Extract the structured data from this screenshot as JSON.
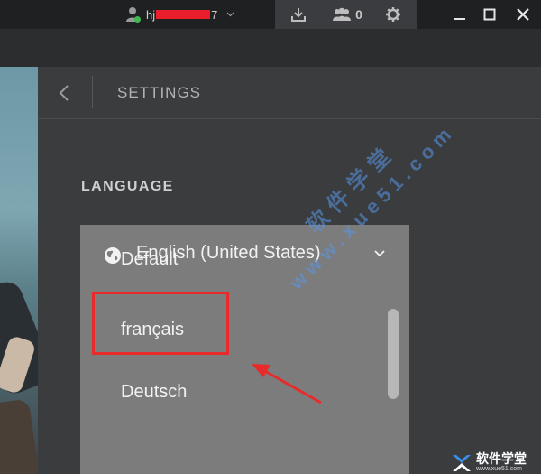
{
  "titlebar": {
    "user_name_start": "hj",
    "user_name_end": "7",
    "friends_count": "0"
  },
  "panel": {
    "title": "SETTINGS"
  },
  "language": {
    "label": "LANGUAGE",
    "current": "English (United States)",
    "options": [
      "Default",
      "français",
      "Deutsch"
    ]
  },
  "watermark": {
    "site_text": "www.xue51.com",
    "cn_text": "软件学堂",
    "logo_cn": "软件学堂",
    "logo_url": "www.xue51.com"
  },
  "colors": {
    "highlight": "#e82a2a",
    "online": "#3fb950",
    "redaction": "#e81e2a"
  }
}
